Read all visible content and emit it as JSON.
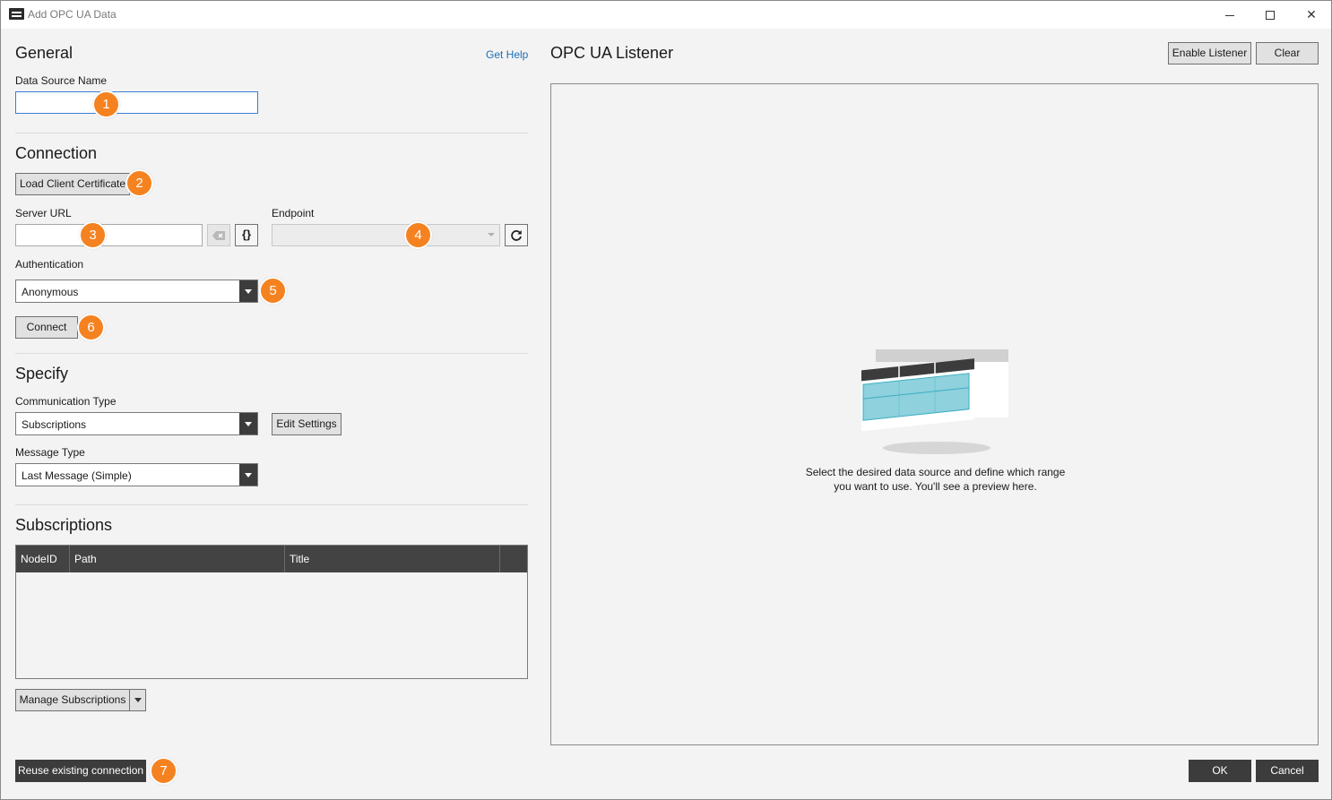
{
  "window": {
    "title": "Add OPC UA Data"
  },
  "general": {
    "heading": "General",
    "help_link": "Get Help",
    "data_source_label": "Data Source Name",
    "data_source_value": ""
  },
  "connection": {
    "heading": "Connection",
    "load_cert_label": "Load Client Certificate",
    "server_url_label": "Server URL",
    "server_url_value": "",
    "endpoint_label": "Endpoint",
    "endpoint_value": "",
    "authentication_label": "Authentication",
    "authentication_value": "Anonymous",
    "connect_label": "Connect"
  },
  "specify": {
    "heading": "Specify",
    "comm_type_label": "Communication Type",
    "comm_type_value": "Subscriptions",
    "edit_settings_label": "Edit Settings",
    "message_type_label": "Message Type",
    "message_type_value": "Last Message (Simple)"
  },
  "subscriptions": {
    "heading": "Subscriptions",
    "columns": [
      "NodeID",
      "Path",
      "Title"
    ],
    "manage_label": "Manage Subscriptions"
  },
  "listener": {
    "heading": "OPC UA Listener",
    "enable_label": "Enable Listener",
    "clear_label": "Clear",
    "preview_line1": "Select the desired data source and define which range",
    "preview_line2": "you want to use. You'll see a preview here."
  },
  "footer": {
    "reuse_label": "Reuse existing connection",
    "ok_label": "OK",
    "cancel_label": "Cancel"
  },
  "badges": [
    "1",
    "2",
    "3",
    "4",
    "5",
    "6",
    "7"
  ],
  "colors": {
    "badge": "#f58220",
    "accent_link": "#1e6fb5",
    "dark_button": "#3c3c3c",
    "grid_header": "#434343",
    "preview_cells": "#7fc9d6"
  }
}
